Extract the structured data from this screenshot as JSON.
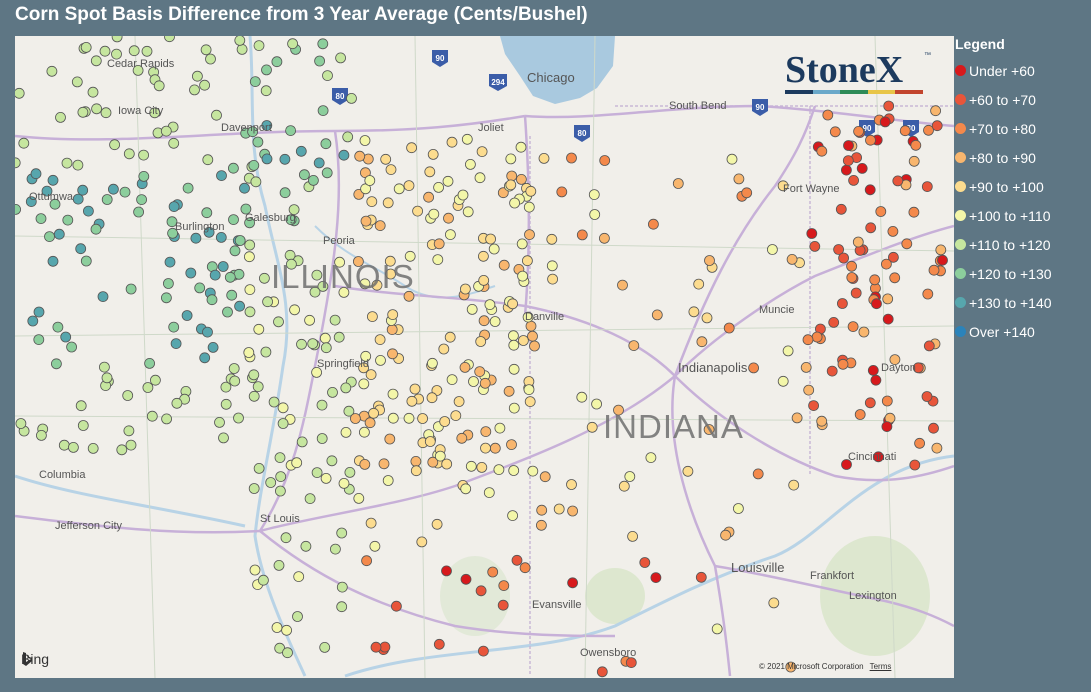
{
  "title": "Corn Spot Basis Difference from 3 Year Average (Cents/Bushel)",
  "legend": {
    "title": "Legend",
    "items": [
      {
        "label": "Under +60",
        "color": "#d7191c"
      },
      {
        "label": "+60 to +70",
        "color": "#e8553a"
      },
      {
        "label": "+70 to +80",
        "color": "#f4894b"
      },
      {
        "label": "+80 to +90",
        "color": "#f8b66e"
      },
      {
        "label": "+90 to +100",
        "color": "#fcdc8f"
      },
      {
        "label": "+100 to +110",
        "color": "#f3f6a9"
      },
      {
        "label": "+110 to +120",
        "color": "#c6e69f"
      },
      {
        "label": "+120 to +130",
        "color": "#8cce9c"
      },
      {
        "label": "+130 to +140",
        "color": "#57a6ad"
      },
      {
        "label": "Over +140",
        "color": "#2b83ba"
      }
    ]
  },
  "map": {
    "states": [
      "ILLINOIS",
      "INDIANA"
    ],
    "cities": [
      "Cedar Rapids",
      "Iowa City",
      "Davenport",
      "Ottumwa",
      "Burlington",
      "Galesburg",
      "Peoria",
      "Joliet",
      "Chicago",
      "South Bend",
      "Fort Wayne",
      "Danville",
      "Springfield",
      "Muncie",
      "Indianapolis",
      "Dayton",
      "Columbia",
      "Jefferson City",
      "St Louis",
      "Cincinnati",
      "Frankfort",
      "Lexington",
      "Louisville",
      "Evansville",
      "Owensboro"
    ],
    "highways": [
      "90",
      "294",
      "80",
      "90",
      "80",
      "90",
      "80"
    ],
    "provider": "Bing",
    "copyright": "© 2021 Microsoft Corporation",
    "terms": "Terms"
  },
  "logo": {
    "text": "StoneX",
    "tm": "™",
    "bar_colors": [
      "#1c3a5e",
      "#6aa8c9",
      "#2e8b57",
      "#e8c547",
      "#c2452d"
    ]
  }
}
